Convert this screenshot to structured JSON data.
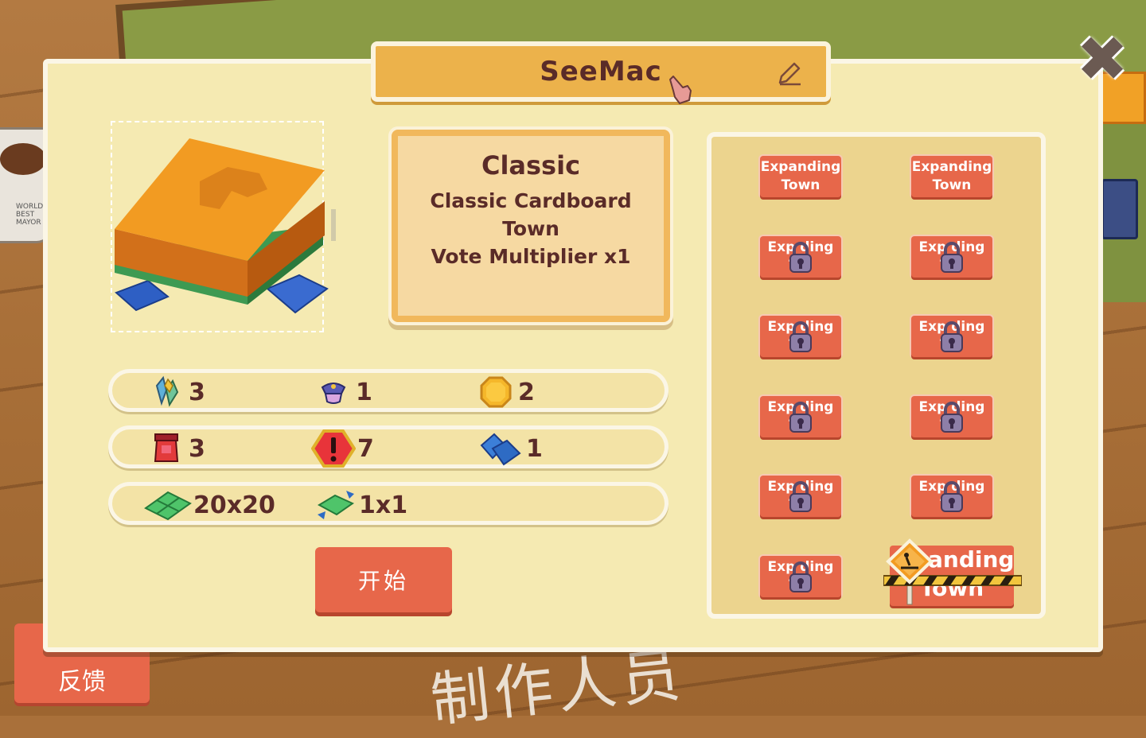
{
  "background": {
    "mug_text": "WORLD BEST MAYOR",
    "chalk_text": "制作人员"
  },
  "feedback_button": {
    "label": "反馈"
  },
  "close_button": {
    "glyph": "✖"
  },
  "town_name": {
    "value": "SeeMac"
  },
  "description": {
    "title": "Classic",
    "lines": [
      "Classic Cardboard",
      "Town",
      "Vote Multiplier x1"
    ]
  },
  "stats": {
    "row1": [
      {
        "icon": "crystal-resource-icon",
        "value": "3"
      },
      {
        "icon": "police-cap-icon",
        "value": "1"
      },
      {
        "icon": "gold-coin-icon",
        "value": "2"
      }
    ],
    "row2": [
      {
        "icon": "red-building-icon",
        "value": "3"
      },
      {
        "icon": "danger-alert-icon",
        "value": "7"
      },
      {
        "icon": "blue-cards-icon",
        "value": "1"
      }
    ],
    "row3": [
      {
        "icon": "map-grid-icon",
        "value": "20x20"
      },
      {
        "icon": "tile-expand-icon",
        "value": "1x1"
      }
    ]
  },
  "start_button": {
    "label": "开始"
  },
  "modes": {
    "unlocked": [
      {
        "line1": "Expanding",
        "line2": "Town"
      },
      {
        "line1": "Expanding",
        "line2": "Town"
      }
    ],
    "locked": [
      {
        "line1": "Exp  ding",
        "line2": "T  n"
      },
      {
        "line1": "Exp  ding",
        "line2": "T  n"
      },
      {
        "line1": "Exp  ding",
        "line2": "T  n"
      },
      {
        "line1": "Exp  ding",
        "line2": "T  n"
      },
      {
        "line1": "Exp  ding",
        "line2": "T  n"
      },
      {
        "line1": "Exp  ding",
        "line2": "T  n"
      },
      {
        "line1": "Exp  ding",
        "line2": "T  n"
      },
      {
        "line1": "Exp  ding",
        "line2": "T  n"
      },
      {
        "line1": "Exp  ding",
        "line2": "T  n"
      }
    ],
    "under_construction": {
      "line1": "anding",
      "line2": "Town"
    }
  },
  "colors": {
    "panel": "#f5eab2",
    "accent_orange": "#ecb24b",
    "button_red": "#e7674a",
    "text_dark": "#5a2b28"
  }
}
